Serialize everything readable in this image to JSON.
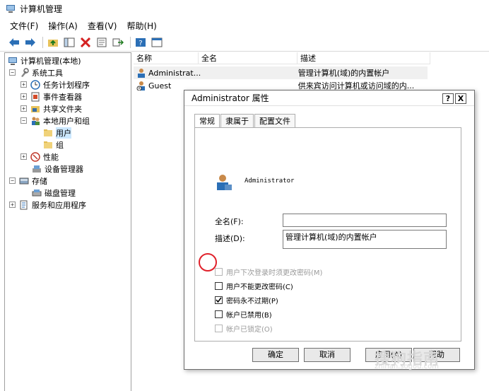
{
  "window": {
    "title": "计算机管理",
    "icon": "computer-management-icon"
  },
  "menu": [
    "文件(F)",
    "操作(A)",
    "查看(V)",
    "帮助(H)"
  ],
  "toolbar_icons": [
    "back-arrow-icon",
    "forward-arrow-icon",
    "up-folder-icon",
    "show-hide-tree-icon",
    "delete-icon",
    "properties-icon",
    "export-icon",
    "help-icon",
    "console-icon"
  ],
  "tree": {
    "items": [
      {
        "label": "计算机管理(本地)",
        "icon": "computer-management-icon",
        "expander": ""
      },
      {
        "label": "系统工具",
        "icon": "tools-icon",
        "expander": "−"
      },
      {
        "label": "任务计划程序",
        "icon": "clock-icon",
        "expander": "+"
      },
      {
        "label": "事件查看器",
        "icon": "event-viewer-icon",
        "expander": "+"
      },
      {
        "label": "共享文件夹",
        "icon": "shared-folder-icon",
        "expander": "+"
      },
      {
        "label": "本地用户和组",
        "icon": "users-icon",
        "expander": "−"
      },
      {
        "label": "用户",
        "icon": "folder-icon",
        "expander": ""
      },
      {
        "label": "组",
        "icon": "folder-icon",
        "expander": ""
      },
      {
        "label": "性能",
        "icon": "performance-icon",
        "expander": "+"
      },
      {
        "label": "设备管理器",
        "icon": "device-manager-icon",
        "expander": ""
      },
      {
        "label": "存储",
        "icon": "storage-icon",
        "expander": "−"
      },
      {
        "label": "磁盘管理",
        "icon": "disk-icon",
        "expander": ""
      },
      {
        "label": "服务和应用程序",
        "icon": "services-icon",
        "expander": "+"
      }
    ]
  },
  "list": {
    "columns": [
      "名称",
      "全名",
      "描述"
    ],
    "rows": [
      {
        "name": "Administrat...",
        "fullname": "",
        "description": "管理计算机(域)的内置帐户"
      },
      {
        "name": "Guest",
        "fullname": "",
        "description": "供来宾访问计算机或访问域的内..."
      }
    ]
  },
  "dialog": {
    "title": "Administrator 属性",
    "help_btn": "?",
    "close_btn": "X",
    "tabs": [
      "常规",
      "隶属于",
      "配置文件"
    ],
    "username": "Administrator",
    "fullname_label": "全名(F):",
    "fullname_value": "",
    "description_label": "描述(D):",
    "description_value": "管理计算机(域)的内置帐户",
    "checkboxes": [
      {
        "label": "用户下次登录时须更改密码(M)",
        "checked": false,
        "disabled": true
      },
      {
        "label": "用户不能更改密码(C)",
        "checked": false,
        "disabled": false
      },
      {
        "label": "密码永不过期(P)",
        "checked": true,
        "disabled": false
      },
      {
        "label": "帐户已禁用(B)",
        "checked": false,
        "disabled": false
      },
      {
        "label": "帐户已锁定(O)",
        "checked": false,
        "disabled": true
      }
    ],
    "buttons": {
      "ok": "确定",
      "cancel": "取消",
      "apply": "应用(A)",
      "help": "帮助"
    }
  },
  "watermark": {
    "main": "搜狗指南",
    "sub": "zhinan.sogou.com"
  },
  "colors": {
    "selection": "#cce8ff",
    "highlight_circle": "#e0202a"
  }
}
